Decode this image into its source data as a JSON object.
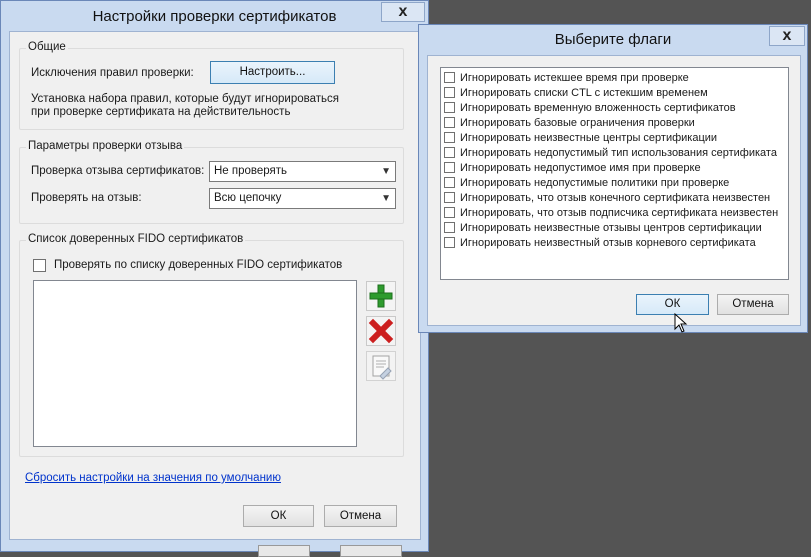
{
  "main_dialog": {
    "title": "Настройки проверки сертификатов",
    "close_glyph": "x",
    "general": {
      "title": "Общие",
      "exceptions_label": "Исключения правил проверки:",
      "configure_button": "Настроить...",
      "description_line1": "Установка набора правил, которые будут игнорироваться",
      "description_line2": "при проверке сертификата на действительность"
    },
    "revocation": {
      "title": "Параметры проверки отзыва",
      "check_label": "Проверка отзыва сертификатов:",
      "check_value": "Не проверять",
      "scope_label": "Проверять на отзыв:",
      "scope_value": "Всю цепочку"
    },
    "fido": {
      "title": "Список доверенных FIDO сертификатов",
      "checkbox_label": "Проверять по списку доверенных FIDO сертификатов",
      "checked": false,
      "items": []
    },
    "reset_link": "Сбросить настройки на значения по умолчанию",
    "ok_button": "ОК",
    "cancel_button": "Отмена"
  },
  "flags_dialog": {
    "title": "Выберите флаги",
    "close_glyph": "x",
    "flags": [
      {
        "label": "Игнорировать истекшее время при проверке",
        "checked": false
      },
      {
        "label": "Игнорировать списки CTL с истекшим временем",
        "checked": false
      },
      {
        "label": "Игнорировать временную вложенность сертификатов",
        "checked": false
      },
      {
        "label": "Игнорировать базовые ограничения проверки",
        "checked": false
      },
      {
        "label": "Игнорировать неизвестные центры сертификации",
        "checked": false
      },
      {
        "label": "Игнорировать недопустимый тип использования сертификата",
        "checked": false
      },
      {
        "label": "Игнорировать недопустимое имя при проверке",
        "checked": false
      },
      {
        "label": "Игнорировать недопустимые политики при проверке",
        "checked": false
      },
      {
        "label": "Игнорировать, что отзыв конечного сертификата неизвестен",
        "checked": false
      },
      {
        "label": "Игнорировать, что отзыв подписчика сертификата неизвестен",
        "checked": false
      },
      {
        "label": "Игнорировать неизвестные отзывы центров сертификации",
        "checked": false
      },
      {
        "label": "Игнорировать неизвестный отзыв корневого сертификата",
        "checked": false
      }
    ],
    "ok_button": "ОК",
    "cancel_button": "Отмена"
  },
  "colors": {
    "window_frame": "#c9daf0",
    "client_bg": "#f0f0f0",
    "desktop": "#545454",
    "link": "#0033cc",
    "add_icon": "#2e9b2e",
    "remove_icon": "#cc1f1f"
  },
  "icons": [
    "add-icon",
    "remove-icon",
    "properties-icon",
    "mouse-cursor"
  ]
}
